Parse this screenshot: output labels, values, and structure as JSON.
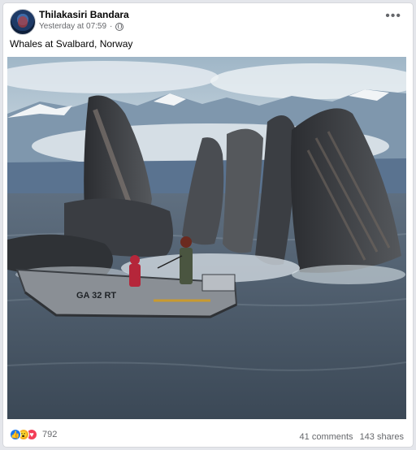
{
  "post": {
    "author": "Thilakasiri Bandara",
    "timestamp": "Yesterday at 07:59",
    "privacy_icon": "globe-icon",
    "more_icon": "more-horizontal-icon",
    "caption": "Whales at Svalbard, Norway",
    "photo": {
      "boat_registration": "GA 32 RT"
    }
  },
  "footer": {
    "reaction_icons": [
      "like-icon",
      "wow-icon",
      "love-icon"
    ],
    "reaction_count": "792",
    "comments": "41 comments",
    "shares": "143 shares"
  },
  "colors": {
    "like": "#1877f2",
    "wow": "#f7b125",
    "love": "#f33e58",
    "meta_text": "#65676b"
  }
}
